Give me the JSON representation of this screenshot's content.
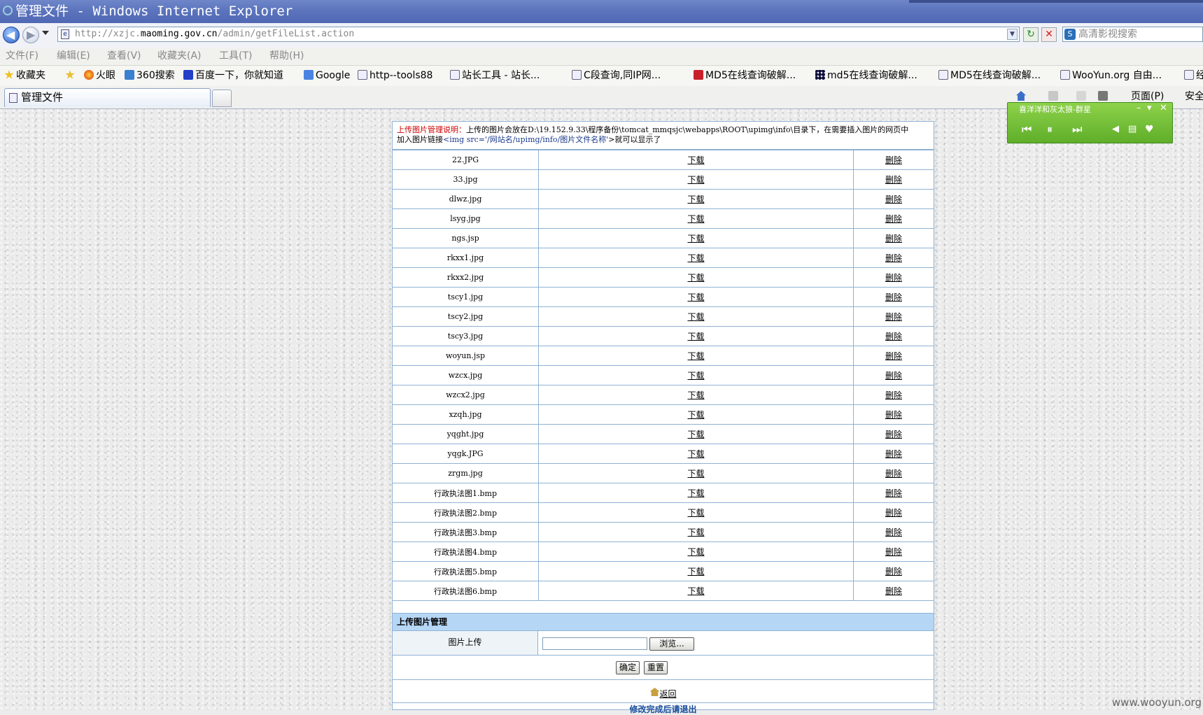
{
  "window": {
    "title": "管理文件 - Windows Internet Explorer"
  },
  "address": {
    "url_prefix": "http://xzjc.",
    "url_domain": "maoming.gov.cn",
    "url_path": "/admin/getFileList.action",
    "search_placeholder": "高清影视搜索"
  },
  "menu": [
    "文件(F)",
    "编辑(E)",
    "查看(V)",
    "收藏夹(A)",
    "工具(T)",
    "帮助(H)"
  ],
  "favorites": {
    "label": "收藏夹",
    "items": [
      "火眼",
      "360搜索",
      "百度一下，你就知道",
      "Google",
      "http--tools88",
      "站长工具 - 站长...",
      "C段查询,同IP网...",
      "MD5在线查询破解...",
      "md5在线查询破解...",
      "MD5在线查询破解...",
      "WooYun.org 自由...",
      "经"
    ]
  },
  "tab": {
    "label": "管理文件"
  },
  "commandbar": {
    "page_label": "页面(P)",
    "safety_label": "安全"
  },
  "notice": {
    "heading": "上传图片管理说明：",
    "line1": "上传的图片会放在D:\\19.152.9.33\\程序备份\\tomcat_mmqsjc\\webapps\\ROOT\\upimg\\info\\目录下，在需要插入图片的网页中",
    "line2_before": "加入图片链接",
    "code": "<img src='/网站名/upimg/info/图片文件名称'",
    "line2_after": ">就可以显示了"
  },
  "file_actions": {
    "download": "下载",
    "delete": "删除"
  },
  "files": [
    "22.JPG",
    "33.jpg",
    "dlwz.jpg",
    "lsyg.jpg",
    "ngs.jsp",
    "rkxx1.jpg",
    "rkxx2.jpg",
    "tscy1.jpg",
    "tscy2.jpg",
    "tscy3.jpg",
    "woyun.jsp",
    "wzcx.jpg",
    "wzcx2.jpg",
    "xzqh.jpg",
    "yqght.jpg",
    "yqgk.JPG",
    "zrgm.jpg",
    "行政执法图1.bmp",
    "行政执法图2.bmp",
    "行政执法图3.bmp",
    "行政执法图4.bmp",
    "行政执法图5.bmp",
    "行政执法图6.bmp"
  ],
  "upload": {
    "section_title": "上传图片管理",
    "label": "图片上传",
    "browse": "浏览...",
    "confirm": "确定",
    "reset": "重置",
    "back": "返回",
    "exit_note": "修改完成后请退出"
  },
  "music": {
    "title": "喜洋洋和灰太狼-群星"
  },
  "watermark": "www.wooyun.org"
}
